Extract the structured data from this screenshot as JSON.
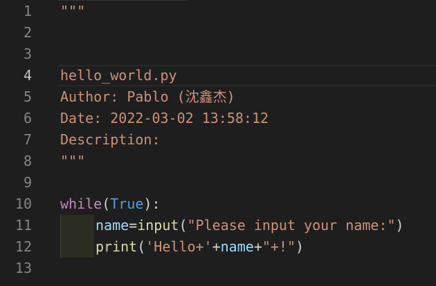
{
  "colors": {
    "background": "#1e1e1e",
    "line_number": "#858585",
    "string": "#ce9178",
    "keyword": "#c586c0",
    "constant": "#569cd6",
    "variable": "#9cdcfe",
    "function": "#dcdcaa",
    "punctuation": "#d4d4d4"
  },
  "editor": {
    "line_numbers": [
      "1",
      "2",
      "3",
      "4",
      "5",
      "6",
      "7",
      "8",
      "9",
      "10",
      "11",
      "12",
      "13"
    ],
    "active_line": "4",
    "lines": {
      "l1": "\"\"\"",
      "l4": "hello_world.py",
      "l5": "Author: Pablo (沈鑫杰)",
      "l6": "Date: 2022-03-02 13:58:12",
      "l7": "Description:",
      "l8": "\"\"\"",
      "l10": {
        "keyword": "while",
        "open": "(",
        "const": "True",
        "close": "):"
      },
      "l11": {
        "var": "name",
        "eq": "=",
        "fn": "input",
        "open": "(",
        "str": "\"Please input your name:\"",
        "close": ")"
      },
      "l12": {
        "fn": "print",
        "open": "(",
        "str1": "'Hello+'",
        "plus1": "+",
        "var": "name",
        "plus2": "+",
        "str2": "\"+!\"",
        "close": ")"
      }
    }
  }
}
